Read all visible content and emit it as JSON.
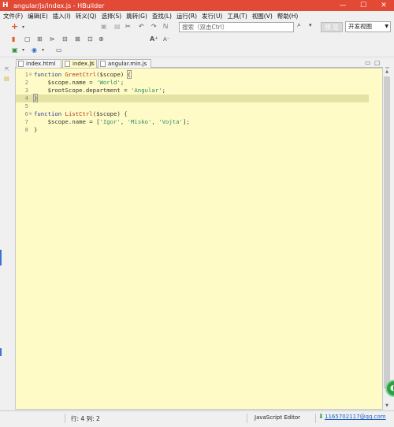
{
  "window": {
    "title": "angular/js/index.js  -  HBuilder",
    "app_letter": "H",
    "controls": {
      "minimize": "—",
      "maximize": "☐",
      "close": "✕"
    }
  },
  "menu": [
    "文件(F)",
    "编辑(E)",
    "插入(I)",
    "转义(Q)",
    "选择(S)",
    "跳转(G)",
    "查找(L)",
    "运行(R)",
    "发行(U)",
    "工具(T)",
    "视图(V)",
    "帮助(H)"
  ],
  "toolbar": {
    "search_placeholder": "搜索（双击Ctrl）",
    "view_button": "预 览",
    "mode_select": "开发视图"
  },
  "tabs": [
    {
      "label": "index.html",
      "active": false
    },
    {
      "label": "index.js",
      "active": true,
      "close": "☒"
    },
    {
      "label": "angular.min.js",
      "active": false
    }
  ],
  "code": {
    "lines": [
      {
        "n": "1",
        "fold": "⊖",
        "tokens": [
          [
            "kw",
            "function "
          ],
          [
            "fn",
            "GreetCtrl"
          ],
          [
            "id",
            "($scope) "
          ],
          [
            "bx",
            "{"
          ]
        ]
      },
      {
        "n": "2",
        "fold": "",
        "tokens": [
          [
            "id",
            "    $scope.name = "
          ],
          [
            "str",
            "'World'"
          ],
          [
            "id",
            ";"
          ]
        ]
      },
      {
        "n": "3",
        "fold": "",
        "tokens": [
          [
            "id",
            "    $rootScope.department = "
          ],
          [
            "str",
            "'Angular'"
          ],
          [
            "id",
            ";"
          ]
        ]
      },
      {
        "n": "4",
        "fold": "",
        "tokens": [
          [
            "bx",
            "}"
          ]
        ]
      },
      {
        "n": "5",
        "fold": "",
        "tokens": []
      },
      {
        "n": "6",
        "fold": "⊖",
        "tokens": [
          [
            "kw",
            "function "
          ],
          [
            "fn",
            "ListCtrl"
          ],
          [
            "id",
            "($scope) {"
          ]
        ]
      },
      {
        "n": "7",
        "fold": "",
        "tokens": [
          [
            "id",
            "    $scope.name = ["
          ],
          [
            "str",
            "'Igor'"
          ],
          [
            "id",
            ", "
          ],
          [
            "str",
            "'Misko'"
          ],
          [
            "id",
            ", "
          ],
          [
            "str",
            "'Vojta'"
          ],
          [
            "id",
            "];"
          ]
        ]
      },
      {
        "n": "8",
        "fold": "",
        "tokens": [
          [
            "id",
            "}"
          ]
        ]
      }
    ],
    "current_line": 4
  },
  "status": {
    "cursor": "行: 4 列: 2",
    "editor_type": "JavaScript Editor",
    "user": "1165702117@qq.com"
  },
  "colors": {
    "title_bg": "#e24a36",
    "editor_bg": "#fffbc7",
    "current_line": "#e5e3a4"
  }
}
